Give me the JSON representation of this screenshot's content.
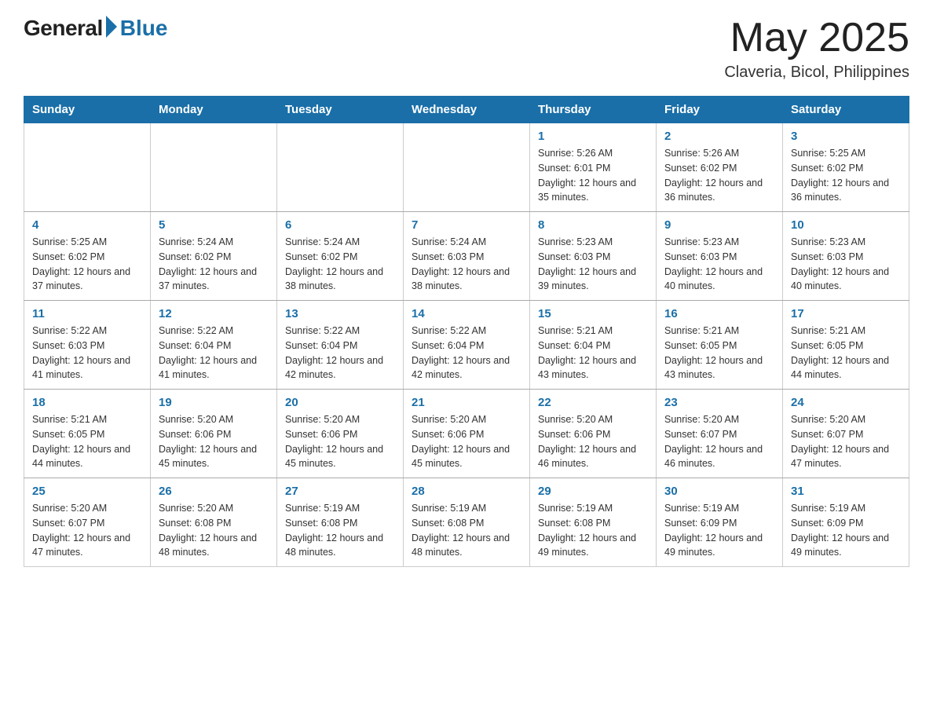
{
  "header": {
    "logo_general": "General",
    "logo_blue": "Blue",
    "month_title": "May 2025",
    "location": "Claveria, Bicol, Philippines"
  },
  "days_of_week": [
    "Sunday",
    "Monday",
    "Tuesday",
    "Wednesday",
    "Thursday",
    "Friday",
    "Saturday"
  ],
  "weeks": [
    [
      {
        "day": "",
        "info": ""
      },
      {
        "day": "",
        "info": ""
      },
      {
        "day": "",
        "info": ""
      },
      {
        "day": "",
        "info": ""
      },
      {
        "day": "1",
        "info": "Sunrise: 5:26 AM\nSunset: 6:01 PM\nDaylight: 12 hours and 35 minutes."
      },
      {
        "day": "2",
        "info": "Sunrise: 5:26 AM\nSunset: 6:02 PM\nDaylight: 12 hours and 36 minutes."
      },
      {
        "day": "3",
        "info": "Sunrise: 5:25 AM\nSunset: 6:02 PM\nDaylight: 12 hours and 36 minutes."
      }
    ],
    [
      {
        "day": "4",
        "info": "Sunrise: 5:25 AM\nSunset: 6:02 PM\nDaylight: 12 hours and 37 minutes."
      },
      {
        "day": "5",
        "info": "Sunrise: 5:24 AM\nSunset: 6:02 PM\nDaylight: 12 hours and 37 minutes."
      },
      {
        "day": "6",
        "info": "Sunrise: 5:24 AM\nSunset: 6:02 PM\nDaylight: 12 hours and 38 minutes."
      },
      {
        "day": "7",
        "info": "Sunrise: 5:24 AM\nSunset: 6:03 PM\nDaylight: 12 hours and 38 minutes."
      },
      {
        "day": "8",
        "info": "Sunrise: 5:23 AM\nSunset: 6:03 PM\nDaylight: 12 hours and 39 minutes."
      },
      {
        "day": "9",
        "info": "Sunrise: 5:23 AM\nSunset: 6:03 PM\nDaylight: 12 hours and 40 minutes."
      },
      {
        "day": "10",
        "info": "Sunrise: 5:23 AM\nSunset: 6:03 PM\nDaylight: 12 hours and 40 minutes."
      }
    ],
    [
      {
        "day": "11",
        "info": "Sunrise: 5:22 AM\nSunset: 6:03 PM\nDaylight: 12 hours and 41 minutes."
      },
      {
        "day": "12",
        "info": "Sunrise: 5:22 AM\nSunset: 6:04 PM\nDaylight: 12 hours and 41 minutes."
      },
      {
        "day": "13",
        "info": "Sunrise: 5:22 AM\nSunset: 6:04 PM\nDaylight: 12 hours and 42 minutes."
      },
      {
        "day": "14",
        "info": "Sunrise: 5:22 AM\nSunset: 6:04 PM\nDaylight: 12 hours and 42 minutes."
      },
      {
        "day": "15",
        "info": "Sunrise: 5:21 AM\nSunset: 6:04 PM\nDaylight: 12 hours and 43 minutes."
      },
      {
        "day": "16",
        "info": "Sunrise: 5:21 AM\nSunset: 6:05 PM\nDaylight: 12 hours and 43 minutes."
      },
      {
        "day": "17",
        "info": "Sunrise: 5:21 AM\nSunset: 6:05 PM\nDaylight: 12 hours and 44 minutes."
      }
    ],
    [
      {
        "day": "18",
        "info": "Sunrise: 5:21 AM\nSunset: 6:05 PM\nDaylight: 12 hours and 44 minutes."
      },
      {
        "day": "19",
        "info": "Sunrise: 5:20 AM\nSunset: 6:06 PM\nDaylight: 12 hours and 45 minutes."
      },
      {
        "day": "20",
        "info": "Sunrise: 5:20 AM\nSunset: 6:06 PM\nDaylight: 12 hours and 45 minutes."
      },
      {
        "day": "21",
        "info": "Sunrise: 5:20 AM\nSunset: 6:06 PM\nDaylight: 12 hours and 45 minutes."
      },
      {
        "day": "22",
        "info": "Sunrise: 5:20 AM\nSunset: 6:06 PM\nDaylight: 12 hours and 46 minutes."
      },
      {
        "day": "23",
        "info": "Sunrise: 5:20 AM\nSunset: 6:07 PM\nDaylight: 12 hours and 46 minutes."
      },
      {
        "day": "24",
        "info": "Sunrise: 5:20 AM\nSunset: 6:07 PM\nDaylight: 12 hours and 47 minutes."
      }
    ],
    [
      {
        "day": "25",
        "info": "Sunrise: 5:20 AM\nSunset: 6:07 PM\nDaylight: 12 hours and 47 minutes."
      },
      {
        "day": "26",
        "info": "Sunrise: 5:20 AM\nSunset: 6:08 PM\nDaylight: 12 hours and 48 minutes."
      },
      {
        "day": "27",
        "info": "Sunrise: 5:19 AM\nSunset: 6:08 PM\nDaylight: 12 hours and 48 minutes."
      },
      {
        "day": "28",
        "info": "Sunrise: 5:19 AM\nSunset: 6:08 PM\nDaylight: 12 hours and 48 minutes."
      },
      {
        "day": "29",
        "info": "Sunrise: 5:19 AM\nSunset: 6:08 PM\nDaylight: 12 hours and 49 minutes."
      },
      {
        "day": "30",
        "info": "Sunrise: 5:19 AM\nSunset: 6:09 PM\nDaylight: 12 hours and 49 minutes."
      },
      {
        "day": "31",
        "info": "Sunrise: 5:19 AM\nSunset: 6:09 PM\nDaylight: 12 hours and 49 minutes."
      }
    ]
  ]
}
